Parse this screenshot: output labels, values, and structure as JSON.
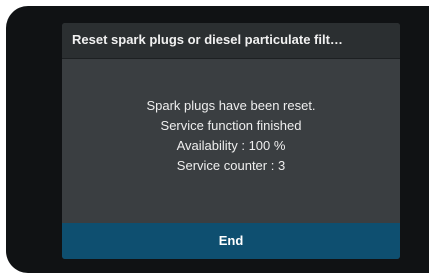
{
  "dialog": {
    "title": "Reset spark plugs or diesel particulate filt…",
    "messages": [
      "Spark plugs have been reset.",
      "Service function finished",
      "Availability : 100 %",
      "Service counter : 3"
    ],
    "end_label": "End"
  },
  "colors": {
    "bezel": "#101214",
    "dialog_background": "#3a3e41",
    "header_background": "#2b2f31",
    "button_background": "#0e4f70",
    "text": "#eeeeee"
  }
}
